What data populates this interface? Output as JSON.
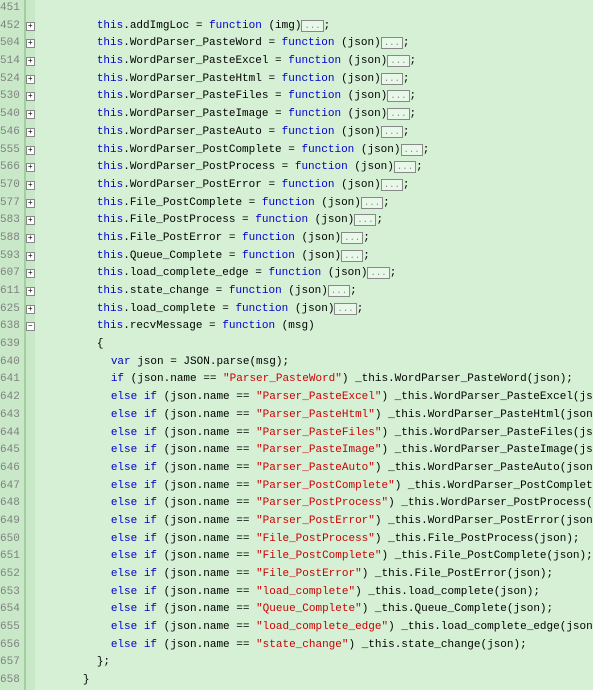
{
  "lines": [
    {
      "num": "451",
      "fold": "",
      "indent": 2,
      "tokens": []
    },
    {
      "num": "452",
      "fold": "+",
      "indent": 2,
      "collapsed": true,
      "tokens": [
        {
          "t": "kw",
          "v": "this"
        },
        {
          "t": "punc",
          "v": "."
        },
        {
          "t": "ident",
          "v": "addImgLoc = "
        },
        {
          "t": "kw",
          "v": "function"
        },
        {
          "t": "ident",
          "v": " (img)"
        },
        {
          "t": "col",
          "v": "..."
        },
        {
          "t": "punc",
          "v": ";"
        }
      ]
    },
    {
      "num": "504",
      "fold": "+",
      "indent": 2,
      "collapsed": true,
      "tokens": [
        {
          "t": "kw",
          "v": "this"
        },
        {
          "t": "punc",
          "v": "."
        },
        {
          "t": "ident",
          "v": "WordParser_PasteWord = "
        },
        {
          "t": "kw",
          "v": "function"
        },
        {
          "t": "ident",
          "v": " (json)"
        },
        {
          "t": "col",
          "v": "..."
        },
        {
          "t": "punc",
          "v": ";"
        }
      ]
    },
    {
      "num": "514",
      "fold": "+",
      "indent": 2,
      "collapsed": true,
      "tokens": [
        {
          "t": "kw",
          "v": "this"
        },
        {
          "t": "punc",
          "v": "."
        },
        {
          "t": "ident",
          "v": "WordParser_PasteExcel = "
        },
        {
          "t": "kw",
          "v": "function"
        },
        {
          "t": "ident",
          "v": " (json)"
        },
        {
          "t": "col",
          "v": "..."
        },
        {
          "t": "punc",
          "v": ";"
        }
      ]
    },
    {
      "num": "524",
      "fold": "+",
      "indent": 2,
      "collapsed": true,
      "tokens": [
        {
          "t": "kw",
          "v": "this"
        },
        {
          "t": "punc",
          "v": "."
        },
        {
          "t": "ident",
          "v": "WordParser_PasteHtml = "
        },
        {
          "t": "kw",
          "v": "function"
        },
        {
          "t": "ident",
          "v": " (json)"
        },
        {
          "t": "col",
          "v": "..."
        },
        {
          "t": "punc",
          "v": ";"
        }
      ]
    },
    {
      "num": "530",
      "fold": "+",
      "indent": 2,
      "collapsed": true,
      "tokens": [
        {
          "t": "kw",
          "v": "this"
        },
        {
          "t": "punc",
          "v": "."
        },
        {
          "t": "ident",
          "v": "WordParser_PasteFiles = "
        },
        {
          "t": "kw",
          "v": "function"
        },
        {
          "t": "ident",
          "v": " (json)"
        },
        {
          "t": "col",
          "v": "..."
        },
        {
          "t": "punc",
          "v": ";"
        }
      ]
    },
    {
      "num": "540",
      "fold": "+",
      "indent": 2,
      "collapsed": true,
      "tokens": [
        {
          "t": "kw",
          "v": "this"
        },
        {
          "t": "punc",
          "v": "."
        },
        {
          "t": "ident",
          "v": "WordParser_PasteImage = "
        },
        {
          "t": "kw",
          "v": "function"
        },
        {
          "t": "ident",
          "v": " (json)"
        },
        {
          "t": "col",
          "v": "..."
        },
        {
          "t": "punc",
          "v": ";"
        }
      ]
    },
    {
      "num": "546",
      "fold": "+",
      "indent": 2,
      "collapsed": true,
      "tokens": [
        {
          "t": "kw",
          "v": "this"
        },
        {
          "t": "punc",
          "v": "."
        },
        {
          "t": "ident",
          "v": "WordParser_PasteAuto = "
        },
        {
          "t": "kw",
          "v": "function"
        },
        {
          "t": "ident",
          "v": " (json)"
        },
        {
          "t": "col",
          "v": "..."
        },
        {
          "t": "punc",
          "v": ";"
        }
      ]
    },
    {
      "num": "555",
      "fold": "+",
      "indent": 2,
      "collapsed": true,
      "tokens": [
        {
          "t": "kw",
          "v": "this"
        },
        {
          "t": "punc",
          "v": "."
        },
        {
          "t": "ident",
          "v": "WordParser_PostComplete = "
        },
        {
          "t": "kw",
          "v": "function"
        },
        {
          "t": "ident",
          "v": " (json)"
        },
        {
          "t": "col",
          "v": "..."
        },
        {
          "t": "punc",
          "v": ";"
        }
      ]
    },
    {
      "num": "566",
      "fold": "+",
      "indent": 2,
      "collapsed": true,
      "tokens": [
        {
          "t": "kw",
          "v": "this"
        },
        {
          "t": "punc",
          "v": "."
        },
        {
          "t": "ident",
          "v": "WordParser_PostProcess = "
        },
        {
          "t": "kw",
          "v": "function"
        },
        {
          "t": "ident",
          "v": " (json)"
        },
        {
          "t": "col",
          "v": "..."
        },
        {
          "t": "punc",
          "v": ";"
        }
      ]
    },
    {
      "num": "570",
      "fold": "+",
      "indent": 2,
      "collapsed": true,
      "tokens": [
        {
          "t": "kw",
          "v": "this"
        },
        {
          "t": "punc",
          "v": "."
        },
        {
          "t": "ident",
          "v": "WordParser_PostError = "
        },
        {
          "t": "kw",
          "v": "function"
        },
        {
          "t": "ident",
          "v": " (json)"
        },
        {
          "t": "col",
          "v": "..."
        },
        {
          "t": "punc",
          "v": ";"
        }
      ]
    },
    {
      "num": "577",
      "fold": "+",
      "indent": 2,
      "collapsed": true,
      "tokens": [
        {
          "t": "kw",
          "v": "this"
        },
        {
          "t": "punc",
          "v": "."
        },
        {
          "t": "ident",
          "v": "File_PostComplete = "
        },
        {
          "t": "kw",
          "v": "function"
        },
        {
          "t": "ident",
          "v": " (json)"
        },
        {
          "t": "col",
          "v": "..."
        },
        {
          "t": "punc",
          "v": ";"
        }
      ]
    },
    {
      "num": "583",
      "fold": "+",
      "indent": 2,
      "collapsed": true,
      "tokens": [
        {
          "t": "kw",
          "v": "this"
        },
        {
          "t": "punc",
          "v": "."
        },
        {
          "t": "ident",
          "v": "File_PostProcess = "
        },
        {
          "t": "kw",
          "v": "function"
        },
        {
          "t": "ident",
          "v": " (json)"
        },
        {
          "t": "col",
          "v": "..."
        },
        {
          "t": "punc",
          "v": ";"
        }
      ]
    },
    {
      "num": "588",
      "fold": "+",
      "indent": 2,
      "collapsed": true,
      "tokens": [
        {
          "t": "kw",
          "v": "this"
        },
        {
          "t": "punc",
          "v": "."
        },
        {
          "t": "ident",
          "v": "File_PostError = "
        },
        {
          "t": "kw",
          "v": "function"
        },
        {
          "t": "ident",
          "v": " (json)"
        },
        {
          "t": "col",
          "v": "..."
        },
        {
          "t": "punc",
          "v": ";"
        }
      ]
    },
    {
      "num": "593",
      "fold": "+",
      "indent": 2,
      "collapsed": true,
      "tokens": [
        {
          "t": "kw",
          "v": "this"
        },
        {
          "t": "punc",
          "v": "."
        },
        {
          "t": "ident",
          "v": "Queue_Complete = "
        },
        {
          "t": "kw",
          "v": "function"
        },
        {
          "t": "ident",
          "v": " (json)"
        },
        {
          "t": "col",
          "v": "..."
        },
        {
          "t": "punc",
          "v": ";"
        }
      ]
    },
    {
      "num": "607",
      "fold": "+",
      "indent": 2,
      "collapsed": true,
      "tokens": [
        {
          "t": "kw",
          "v": "this"
        },
        {
          "t": "punc",
          "v": "."
        },
        {
          "t": "ident",
          "v": "load_complete_edge = "
        },
        {
          "t": "kw",
          "v": "function"
        },
        {
          "t": "ident",
          "v": " (json)"
        },
        {
          "t": "col",
          "v": "..."
        },
        {
          "t": "punc",
          "v": ";"
        }
      ]
    },
    {
      "num": "611",
      "fold": "+",
      "indent": 2,
      "collapsed": true,
      "tokens": [
        {
          "t": "kw",
          "v": "this"
        },
        {
          "t": "punc",
          "v": "."
        },
        {
          "t": "ident",
          "v": "state_change = "
        },
        {
          "t": "kw",
          "v": "function"
        },
        {
          "t": "ident",
          "v": " (json)"
        },
        {
          "t": "col",
          "v": "..."
        },
        {
          "t": "punc",
          "v": ";"
        }
      ]
    },
    {
      "num": "625",
      "fold": "+",
      "indent": 2,
      "collapsed": true,
      "tokens": [
        {
          "t": "kw",
          "v": "this"
        },
        {
          "t": "punc",
          "v": "."
        },
        {
          "t": "ident",
          "v": "load_complete = "
        },
        {
          "t": "kw",
          "v": "function"
        },
        {
          "t": "ident",
          "v": " (json)"
        },
        {
          "t": "col",
          "v": "..."
        },
        {
          "t": "punc",
          "v": ";"
        }
      ]
    },
    {
      "num": "638",
      "fold": "-",
      "indent": 2,
      "tokens": [
        {
          "t": "kw",
          "v": "this"
        },
        {
          "t": "punc",
          "v": "."
        },
        {
          "t": "ident",
          "v": "recvMessage = "
        },
        {
          "t": "kw",
          "v": "function"
        },
        {
          "t": "ident",
          "v": " (msg)"
        }
      ]
    },
    {
      "num": "639",
      "fold": "",
      "indent": 2,
      "tokens": [
        {
          "t": "punc",
          "v": "{"
        }
      ]
    },
    {
      "num": "640",
      "fold": "",
      "indent": 3,
      "tokens": [
        {
          "t": "kw",
          "v": "var"
        },
        {
          "t": "ident",
          "v": " json = JSON.parse(msg);"
        }
      ]
    },
    {
      "num": "641",
      "fold": "",
      "indent": 3,
      "tokens": [
        {
          "t": "kw",
          "v": "if"
        },
        {
          "t": "ident",
          "v": "      (json.name == "
        },
        {
          "t": "str",
          "v": "\"Parser_PasteWord\""
        },
        {
          "t": "ident",
          "v": ") _this.WordParser_PasteWord(json);"
        }
      ]
    },
    {
      "num": "642",
      "fold": "",
      "indent": 3,
      "tokens": [
        {
          "t": "kw",
          "v": "else if"
        },
        {
          "t": "ident",
          "v": " (json.name == "
        },
        {
          "t": "str",
          "v": "\"Parser_PasteExcel\""
        },
        {
          "t": "ident",
          "v": ") _this.WordParser_PasteExcel(json);"
        }
      ]
    },
    {
      "num": "643",
      "fold": "",
      "indent": 3,
      "tokens": [
        {
          "t": "kw",
          "v": "else if"
        },
        {
          "t": "ident",
          "v": " (json.name == "
        },
        {
          "t": "str",
          "v": "\"Parser_PasteHtml\""
        },
        {
          "t": "ident",
          "v": ") _this.WordParser_PasteHtml(json);"
        }
      ]
    },
    {
      "num": "644",
      "fold": "",
      "indent": 3,
      "tokens": [
        {
          "t": "kw",
          "v": "else if"
        },
        {
          "t": "ident",
          "v": " (json.name == "
        },
        {
          "t": "str",
          "v": "\"Parser_PasteFiles\""
        },
        {
          "t": "ident",
          "v": ") _this.WordParser_PasteFiles(json);"
        }
      ]
    },
    {
      "num": "645",
      "fold": "",
      "indent": 3,
      "tokens": [
        {
          "t": "kw",
          "v": "else if"
        },
        {
          "t": "ident",
          "v": " (json.name == "
        },
        {
          "t": "str",
          "v": "\"Parser_PasteImage\""
        },
        {
          "t": "ident",
          "v": ") _this.WordParser_PasteImage(json);"
        }
      ]
    },
    {
      "num": "646",
      "fold": "",
      "indent": 3,
      "tokens": [
        {
          "t": "kw",
          "v": "else if"
        },
        {
          "t": "ident",
          "v": " (json.name == "
        },
        {
          "t": "str",
          "v": "\"Parser_PasteAuto\""
        },
        {
          "t": "ident",
          "v": ") _this.WordParser_PasteAuto(json);"
        }
      ]
    },
    {
      "num": "647",
      "fold": "",
      "indent": 3,
      "tokens": [
        {
          "t": "kw",
          "v": "else if"
        },
        {
          "t": "ident",
          "v": " (json.name == "
        },
        {
          "t": "str",
          "v": "\"Parser_PostComplete\""
        },
        {
          "t": "ident",
          "v": ") _this.WordParser_PostComplete(json);"
        }
      ]
    },
    {
      "num": "648",
      "fold": "",
      "indent": 3,
      "tokens": [
        {
          "t": "kw",
          "v": "else if"
        },
        {
          "t": "ident",
          "v": " (json.name == "
        },
        {
          "t": "str",
          "v": "\"Parser_PostProcess\""
        },
        {
          "t": "ident",
          "v": ") _this.WordParser_PostProcess(json);"
        }
      ]
    },
    {
      "num": "649",
      "fold": "",
      "indent": 3,
      "tokens": [
        {
          "t": "kw",
          "v": "else if"
        },
        {
          "t": "ident",
          "v": " (json.name == "
        },
        {
          "t": "str",
          "v": "\"Parser_PostError\""
        },
        {
          "t": "ident",
          "v": ") _this.WordParser_PostError(json);"
        }
      ]
    },
    {
      "num": "650",
      "fold": "",
      "indent": 3,
      "tokens": [
        {
          "t": "kw",
          "v": "else if"
        },
        {
          "t": "ident",
          "v": " (json.name == "
        },
        {
          "t": "str",
          "v": "\"File_PostProcess\""
        },
        {
          "t": "ident",
          "v": ") _this.File_PostProcess(json);"
        }
      ]
    },
    {
      "num": "651",
      "fold": "",
      "indent": 3,
      "tokens": [
        {
          "t": "kw",
          "v": "else if"
        },
        {
          "t": "ident",
          "v": " (json.name == "
        },
        {
          "t": "str",
          "v": "\"File_PostComplete\""
        },
        {
          "t": "ident",
          "v": ") _this.File_PostComplete(json);"
        }
      ]
    },
    {
      "num": "652",
      "fold": "",
      "indent": 3,
      "tokens": [
        {
          "t": "kw",
          "v": "else if"
        },
        {
          "t": "ident",
          "v": " (json.name == "
        },
        {
          "t": "str",
          "v": "\"File_PostError\""
        },
        {
          "t": "ident",
          "v": ") _this.File_PostError(json);"
        }
      ]
    },
    {
      "num": "653",
      "fold": "",
      "indent": 3,
      "tokens": [
        {
          "t": "kw",
          "v": "else if"
        },
        {
          "t": "ident",
          "v": " (json.name == "
        },
        {
          "t": "str",
          "v": "\"load_complete\""
        },
        {
          "t": "ident",
          "v": ") _this.load_complete(json);"
        }
      ]
    },
    {
      "num": "654",
      "fold": "",
      "indent": 3,
      "tokens": [
        {
          "t": "kw",
          "v": "else if"
        },
        {
          "t": "ident",
          "v": " (json.name == "
        },
        {
          "t": "str",
          "v": "\"Queue_Complete\""
        },
        {
          "t": "ident",
          "v": ") _this.Queue_Complete(json);"
        }
      ]
    },
    {
      "num": "655",
      "fold": "",
      "indent": 3,
      "tokens": [
        {
          "t": "kw",
          "v": "else if"
        },
        {
          "t": "ident",
          "v": " (json.name == "
        },
        {
          "t": "str",
          "v": "\"load_complete_edge\""
        },
        {
          "t": "ident",
          "v": ") _this.load_complete_edge(json);"
        }
      ]
    },
    {
      "num": "656",
      "fold": "",
      "indent": 3,
      "tokens": [
        {
          "t": "kw",
          "v": "else if"
        },
        {
          "t": "ident",
          "v": " (json.name == "
        },
        {
          "t": "str",
          "v": "\"state_change\""
        },
        {
          "t": "ident",
          "v": ") _this.state_change(json);"
        }
      ]
    },
    {
      "num": "657",
      "fold": "",
      "indent": 2,
      "tokens": [
        {
          "t": "punc",
          "v": "};"
        }
      ]
    },
    {
      "num": "658",
      "fold": "",
      "indent": 1,
      "tokens": [
        {
          "t": "punc",
          "v": "}"
        }
      ]
    }
  ],
  "fold_plus": "+",
  "fold_minus": "−"
}
